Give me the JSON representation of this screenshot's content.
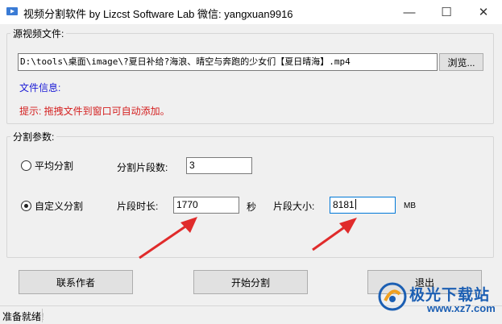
{
  "window": {
    "title": "视频分割软件 by Lizcst Software Lab  微信: yangxuan9916",
    "icon": "video-scissors-icon",
    "min_glyph": "—",
    "max_glyph": "☐",
    "close_glyph": "✕"
  },
  "source_group": {
    "legend": "源视频文件:",
    "path_value": "D:\\tools\\桌面\\image\\?夏日补给?海浪、晴空与奔跑的少女们【夏日晴海】.mp4",
    "browse_label": "浏览...",
    "info_label": "文件信息:",
    "tip_label": "提示: 拖拽文件到窗口可自动添加。"
  },
  "split_group": {
    "legend": "分割参数:",
    "average_option": "平均分割",
    "average_checked": false,
    "segment_count_label": "分割片段数:",
    "segment_count_value": "3",
    "custom_option": "自定义分割",
    "custom_checked": true,
    "duration_label": "片段时长:",
    "duration_value": "1770",
    "duration_unit": "秒",
    "size_label": "片段大小:",
    "size_value": "8181",
    "size_unit": "MB"
  },
  "actions": {
    "contact_label": "联系作者",
    "start_label": "开始分割",
    "exit_label": "退出"
  },
  "status": {
    "text": "准备就绪!"
  },
  "annotations": {
    "arrow_color": "#e02b2b"
  },
  "watermark": {
    "name": "极光下载站",
    "url": "www.xz7.com"
  },
  "colors": {
    "info_blue": "#1a1ad6",
    "tip_red": "#d42020",
    "focus_border": "#0078d7"
  }
}
